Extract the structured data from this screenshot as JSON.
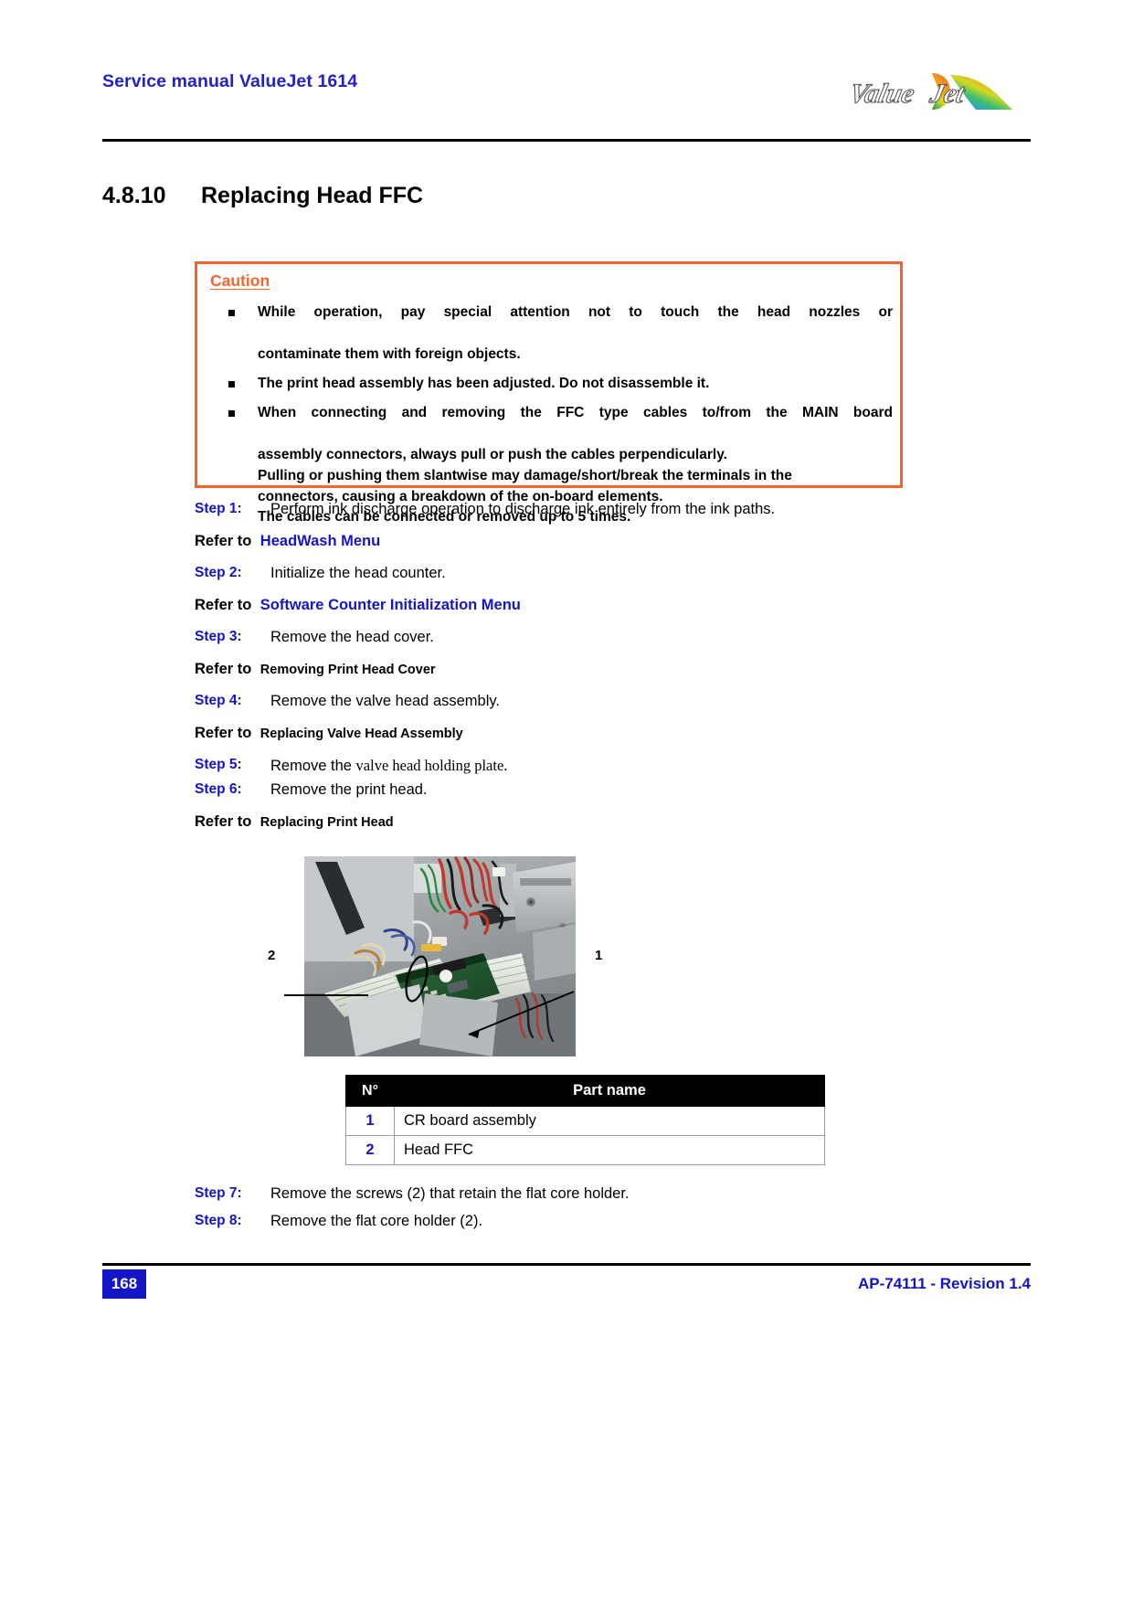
{
  "header": {
    "title": "Service manual ValueJet 1614",
    "logo_name": "valuejet-logo",
    "logo_text": "ValueJet"
  },
  "section": {
    "number": "4.8.10",
    "title": "Replacing Head FFC"
  },
  "caution": {
    "title": "Caution",
    "items": [
      {
        "lines": [
          "While operation, pay special attention not to touch the head nozzles or",
          "contaminate them with foreign objects."
        ]
      },
      {
        "lines": [
          "The print head assembly has been adjusted. Do not disassemble it."
        ]
      },
      {
        "lines": [
          "When connecting and removing the FFC type cables to/from the MAIN board",
          "assembly connectors, always pull or push the cables perpendicularly.",
          "Pulling or pushing them slantwise may damage/short/break the terminals in the",
          "connectors, causing a breakdown of the on-board elements.",
          "The cables can be connected or removed up to 5 times."
        ]
      }
    ]
  },
  "steps": [
    {
      "label": "Step 1:",
      "text": "Perform ink discharge operation to discharge ink entirely from the ink paths."
    },
    {
      "label": "Step 2:",
      "text": "Initialize the head counter."
    },
    {
      "label": "Step 3:",
      "text": "Remove the head cover."
    },
    {
      "label": "Step 4:",
      "text": "Remove the valve head assembly."
    },
    {
      "label": "Step 5:",
      "text_plain": "Remove the ",
      "text_serif": "valve head holding plate."
    },
    {
      "label": "Step 6:",
      "text": "Remove the print head."
    },
    {
      "label": "Step 7:",
      "text": "Remove the screws (2) that retain the flat core holder."
    },
    {
      "label": "Step 8:",
      "text": "Remove the flat core holder (2)."
    }
  ],
  "refers": [
    {
      "label": "Refer to",
      "target": "HeadWash Menu",
      "style": "link"
    },
    {
      "label": "Refer to",
      "target": "Software Counter Initialization Menu",
      "style": "link"
    },
    {
      "label": "Refer to",
      "target": "Removing Print Head Cover",
      "style": "plain"
    },
    {
      "label": "Refer to",
      "target": "Replacing Valve Head Assembly",
      "style": "plain"
    },
    {
      "label": "Refer to",
      "target": "Replacing Print Head",
      "style": "plain"
    }
  ],
  "figure": {
    "callout_left": "2",
    "callout_right": "1",
    "alt": "Photo of carriage showing CR board assembly and head FFC"
  },
  "parts_table": {
    "headers": [
      "N°",
      "Part name"
    ],
    "rows": [
      {
        "n": "1",
        "name": "CR board assembly"
      },
      {
        "n": "2",
        "name": "Head FFC"
      }
    ]
  },
  "footer": {
    "page_number": "168",
    "reference": "AP-74111 - Revision 1.4"
  },
  "colors": {
    "header_blue": "#2222cc",
    "step_blue": "#1414c8",
    "caution_orange": "#f4642b",
    "table_header_bg": "#000000"
  }
}
